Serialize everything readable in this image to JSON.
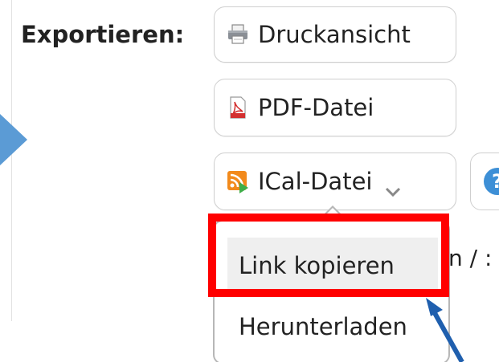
{
  "export_label": "Exportieren:",
  "buttons": {
    "print_label": "Druckansicht",
    "pdf_label": "PDF-Datei",
    "ical_label": "ICal-Datei",
    "help_symbol": "?"
  },
  "icons": {
    "print": "printer-icon",
    "pdf": "pdf-file-icon",
    "ical": "rss-feed-icon",
    "dropdown": "chevron-down-icon",
    "help": "help-icon"
  },
  "dropdown": {
    "items": [
      {
        "label": "Link kopieren"
      },
      {
        "label": "Herunterladen"
      }
    ]
  },
  "background_text": "n / :",
  "colors": {
    "highlight": "#ff0000",
    "arrow": "#1f5fae",
    "nav_nub": "#5b9bd5",
    "help_circle": "#3d8fd6",
    "hover_item": "#efefef"
  }
}
